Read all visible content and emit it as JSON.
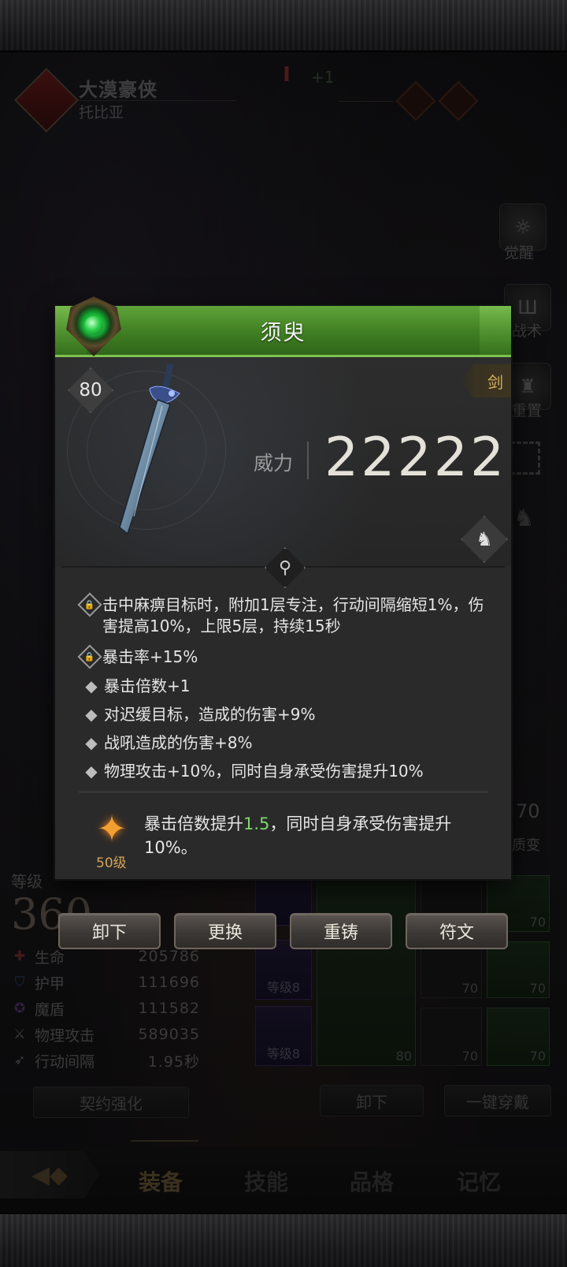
{
  "hero": {
    "name": "大漠豪侠",
    "subtitle": "托比亚",
    "rank_bonus": "+1"
  },
  "side_menu": [
    {
      "label": "觉醒",
      "icon": "sun-icon"
    },
    {
      "label": "战术",
      "icon": "tactics-icon"
    },
    {
      "label": "重置",
      "icon": "helmet-icon"
    }
  ],
  "evolve": {
    "value": "70",
    "label": "质变"
  },
  "stats": {
    "level_label": "等级",
    "level_value": "360",
    "rows": [
      {
        "name": "生命",
        "value": "205786",
        "icon": "heart-icon"
      },
      {
        "name": "护甲",
        "value": "111696",
        "icon": "shield-icon"
      },
      {
        "name": "魔盾",
        "value": "111582",
        "icon": "magic-shield-icon"
      },
      {
        "name": "物理攻击",
        "value": "589035",
        "icon": "sword-icon"
      },
      {
        "name": "行动间隔",
        "value": "1.95秒",
        "icon": "speed-icon"
      }
    ],
    "contract_button": "契约强化"
  },
  "equipment": {
    "slots": [
      {
        "tag": "等级8"
      },
      {
        "tag": "等级8"
      },
      {
        "level": "70"
      },
      {
        "level": "70"
      },
      {
        "level": "70"
      },
      {
        "level": "70"
      },
      {
        "level": "70"
      },
      {
        "level": "70"
      },
      {
        "level": "80"
      }
    ],
    "unequip_button": "卸下",
    "quick_equip_button": "一键穿戴"
  },
  "tabs": [
    {
      "label": "装备",
      "active": true
    },
    {
      "label": "技能",
      "active": false
    },
    {
      "label": "品格",
      "active": false
    },
    {
      "label": "记忆",
      "active": false
    }
  ],
  "popup": {
    "title": "须臾",
    "item_level": "80",
    "weapon_type": "剑",
    "power_label": "威力",
    "power_value": "22222",
    "affixes": [
      {
        "locked": true,
        "text": "击中麻痹目标时，附加1层专注，行动间隔缩短1%，伤害提高10%，上限5层，持续15秒"
      },
      {
        "locked": true,
        "text": "暴击率+15%"
      },
      {
        "locked": false,
        "text": "暴击倍数+1"
      },
      {
        "locked": false,
        "text": "对迟缓目标，造成的伤害+9%"
      },
      {
        "locked": false,
        "text": "战吼造成的伤害+8%"
      },
      {
        "locked": false,
        "text": "物理攻击+10%，同时自身承受伤害提升10%"
      }
    ],
    "skill": {
      "level_tag": "50级",
      "text_before": "暴击倍数提升",
      "highlight": "1.5",
      "text_after": "，同时自身承受伤害提升10%。"
    },
    "buttons": {
      "unequip": "卸下",
      "replace": "更换",
      "reforge": "重铸",
      "rune": "符文"
    },
    "colors": {
      "header_green": "#3f7e22",
      "gem_green": "#2ad048",
      "highlight_green": "#7bd86b",
      "type_gold": "#d7b35a"
    }
  }
}
